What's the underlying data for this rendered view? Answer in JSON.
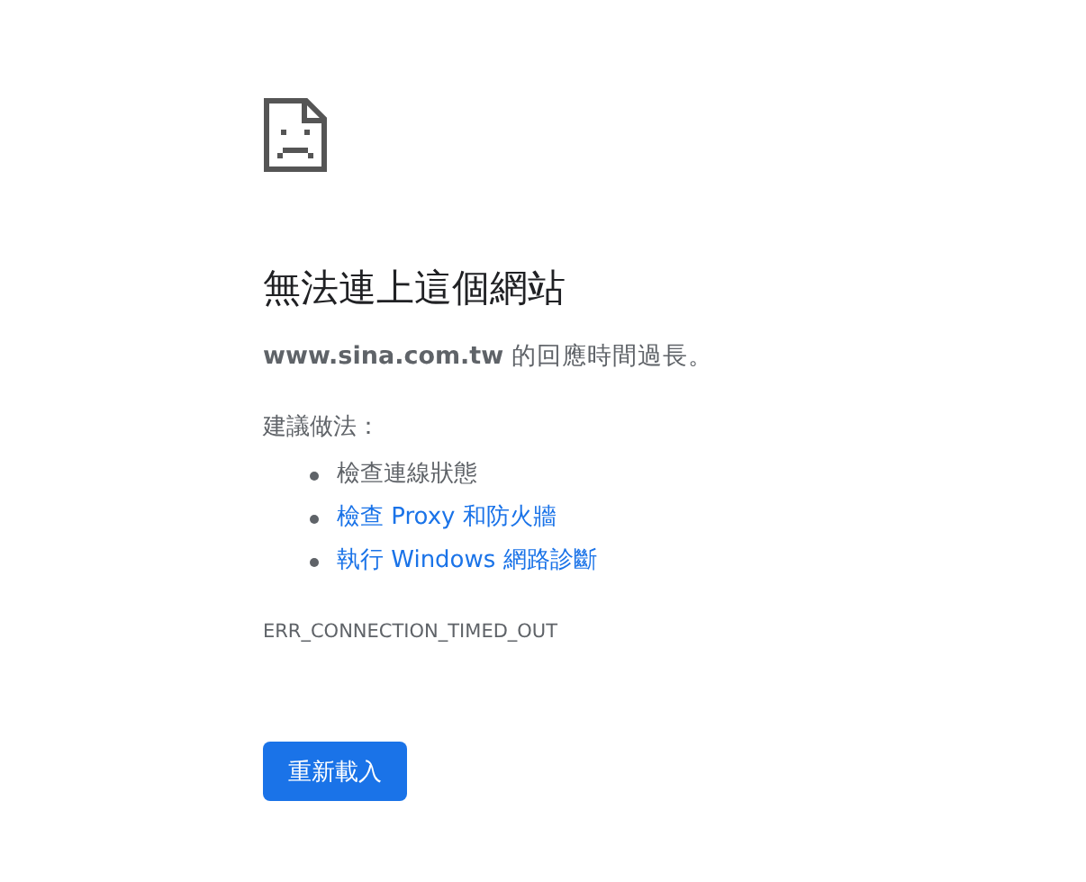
{
  "heading": "無法連上這個網站",
  "message": "**www.sina.com.tw** 的回應時間過長。",
  "suggestions_label": "建議做法：",
  "suggestions": [
    {
      "kind": "text",
      "label": "檢查連線狀態"
    },
    {
      "kind": "link",
      "label": "檢查 Proxy 和防火牆"
    },
    {
      "kind": "link",
      "label": "執行 Windows 網路診斷"
    }
  ],
  "error_code": "ERR_CONNECTION_TIMED_OUT",
  "buttons": [
    "重新載入"
  ]
}
